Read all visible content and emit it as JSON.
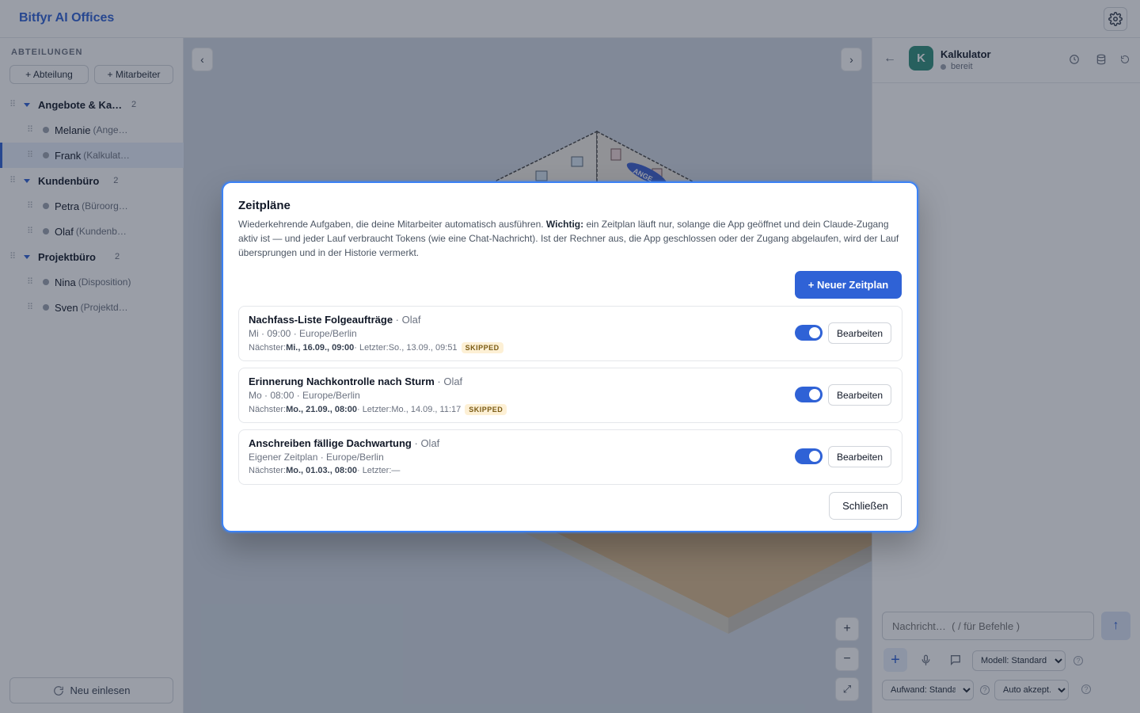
{
  "app": {
    "title": "Bitfyr AI Offices"
  },
  "sidebar": {
    "heading": "ABTEILUNGEN",
    "add_department": "+ Abteilung",
    "add_employee": "+ Mitarbeiter",
    "reload": "Neu einlesen",
    "departments": [
      {
        "name": "Angebote & Kal…",
        "count": "2",
        "employees": [
          {
            "name": "Melanie",
            "role": "(Ange…"
          },
          {
            "name": "Frank",
            "role": "(Kalkulat…",
            "active": true
          }
        ]
      },
      {
        "name": "Kundenbüro",
        "count": "2",
        "employees": [
          {
            "name": "Petra",
            "role": "(Büroorg…"
          },
          {
            "name": "Olaf",
            "role": "(Kundenbe…"
          }
        ]
      },
      {
        "name": "Projektbüro",
        "count": "2",
        "employees": [
          {
            "name": "Nina",
            "role": "(Disposition)"
          },
          {
            "name": "Sven",
            "role": "(Projektd…"
          }
        ]
      }
    ]
  },
  "canvas": {
    "prev": "‹",
    "next": "›",
    "zoom_in": "+",
    "zoom_out": "−",
    "fit": "⤢",
    "sign_text": "ANGE"
  },
  "chat": {
    "back": "←",
    "avatar_letter": "K",
    "agent_name": "Kalkulator",
    "agent_status": "bereit",
    "input_placeholder": "Nachricht…  ( / für Befehle )",
    "send": "↑",
    "model_select": "Modell: Standard",
    "effort_select": "Aufwand: Standa",
    "accept_select": "Auto akzept.",
    "help": "?"
  },
  "modal": {
    "title": "Zeitpläne",
    "desc_pre": "Wiederkehrende Aufgaben, die deine Mitarbeiter automatisch ausführen. ",
    "desc_bold": "Wichtig:",
    "desc_post": " ein Zeitplan läuft nur, solange die App geöffnet und dein Claude-Zugang aktiv ist — und jeder Lauf verbraucht Tokens (wie eine Chat-Nachricht). Ist der Rechner aus, die App geschlossen oder der Zugang abgelaufen, wird der Lauf übersprungen und in der Historie vermerkt.",
    "new_button": "+ Neuer Zeitplan",
    "close_button": "Schließen",
    "edit_label": "Bearbeiten",
    "schedules": [
      {
        "name": "Nachfass-Liste Folgeaufträge",
        "owner": "Olaf",
        "schedule": "Mi · 09:00 · Europe/Berlin",
        "next_label": "Nächster: ",
        "next_value": "Mi., 16.09., 09:00",
        "last_label": " · Letzter: ",
        "last_value": "So., 13.09., 09:51",
        "badge": "SKIPPED",
        "enabled": true
      },
      {
        "name": "Erinnerung Nachkontrolle nach Sturm",
        "owner": "Olaf",
        "schedule": "Mo · 08:00 · Europe/Berlin",
        "next_label": "Nächster: ",
        "next_value": "Mo., 21.09., 08:00",
        "last_label": " · Letzter: ",
        "last_value": "Mo., 14.09., 11:17",
        "badge": "SKIPPED",
        "enabled": true
      },
      {
        "name": "Anschreiben fällige Dachwartung",
        "owner": "Olaf",
        "schedule": "Eigener Zeitplan · Europe/Berlin",
        "next_label": "Nächster: ",
        "next_value": "Mo., 01.03., 08:00",
        "last_label": " · Letzter: ",
        "last_value": "—",
        "badge": "",
        "enabled": true
      }
    ]
  }
}
